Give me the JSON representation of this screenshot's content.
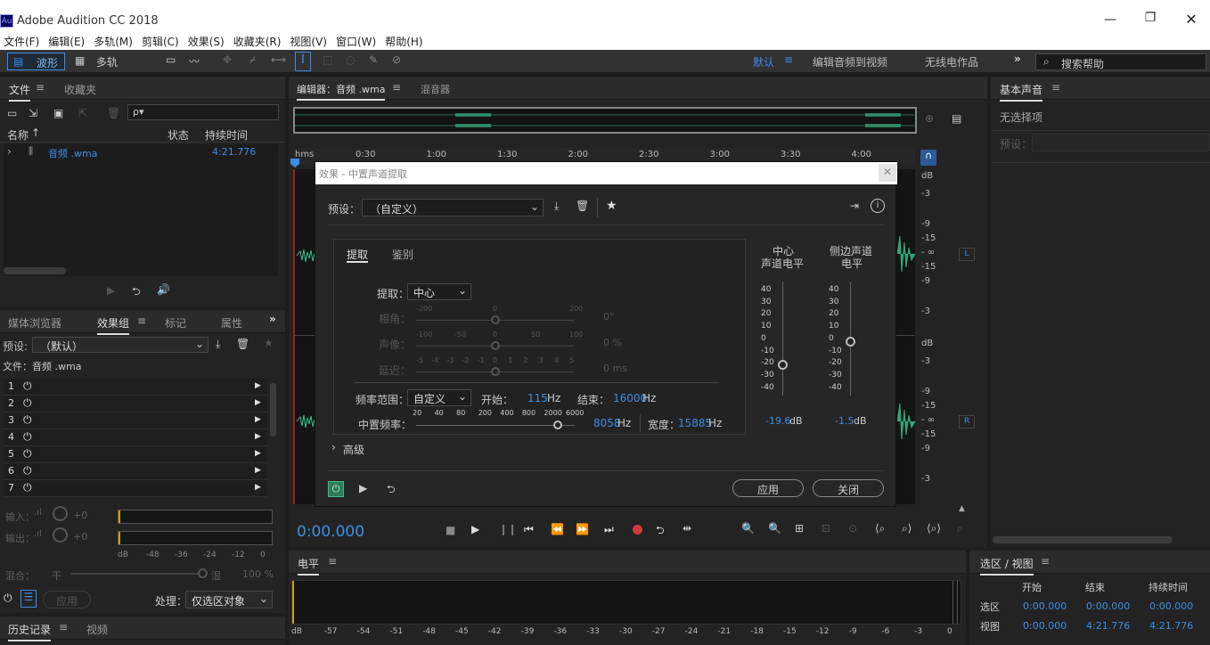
{
  "app": {
    "title": "Adobe Audition CC 2018",
    "logo": "Au"
  },
  "menu": [
    "文件(F)",
    "编辑(E)",
    "多轨(M)",
    "剪辑(C)",
    "效果(S)",
    "收藏夹(R)",
    "视图(V)",
    "窗口(W)",
    "帮助(H)"
  ],
  "toolbar": {
    "waveform_label": "波形",
    "multitrack_label": "多轨",
    "workspaces": [
      "默认",
      "编辑音频到视频",
      "无线电作品"
    ],
    "search_placeholder": "搜索帮助"
  },
  "files_panel": {
    "tabs": [
      "文件",
      "收藏夹"
    ],
    "col_name": "名称",
    "col_status": "状态",
    "col_duration": "持续时间",
    "file_name": "音频 .wma",
    "file_duration": "4:21.776",
    "search_placeholder": "ρ▾"
  },
  "effects_panel": {
    "tabs": [
      "媒体浏览器",
      "效果组",
      "标记",
      "属性"
    ],
    "preset_label": "预设:",
    "preset_value": "（默认）",
    "file_label": "文件：音频 .wma",
    "slots": [
      "1",
      "2",
      "3",
      "4",
      "5",
      "6",
      "7"
    ],
    "input_label": "输入：",
    "output_label": "输出：",
    "input_db": "+0",
    "output_db": "+0",
    "meter_ticks": [
      "dB",
      "-48",
      "-36",
      "-24",
      "-12",
      "0"
    ],
    "mix_label": "混合：",
    "mix_dry": "干",
    "mix_wet": "湿",
    "mix_pct": "100 %",
    "apply_label": "应用",
    "process_label": "处理：",
    "process_value": "仅选区对象"
  },
  "history": {
    "tabs": [
      "历史记录",
      "视频"
    ]
  },
  "editor": {
    "tab_editor": "编辑器：音频 .wma",
    "tab_mixer": "混音器",
    "timecode": "0:00.000",
    "ruler": [
      "hms",
      "0:30",
      "1:00",
      "1:30",
      "2:00",
      "2:30",
      "3:00",
      "3:30",
      "4:00"
    ],
    "db_top": [
      "dB",
      "-3",
      "-9",
      "-15",
      "- ∞",
      "-15",
      "-9",
      "-3"
    ],
    "db_bottom": [
      "dB",
      "-3",
      "-9",
      "-15",
      "- ∞",
      "-15",
      "-9",
      "-3"
    ],
    "ch_left": "L",
    "ch_right": "R"
  },
  "levels": {
    "title": "电平",
    "ticks": [
      "dB",
      "-57",
      "-54",
      "-51",
      "-48",
      "-45",
      "-42",
      "-39",
      "-36",
      "-33",
      "-30",
      "-27",
      "-24",
      "-21",
      "-18",
      "-15",
      "-12",
      "-9",
      "-6",
      "-3",
      "0"
    ]
  },
  "essential_sound": {
    "title": "基本声音",
    "no_selection": "无选择项",
    "preset_label": "预设："
  },
  "selection_view": {
    "title": "选区 / 视图",
    "col_start": "开始",
    "col_end": "结束",
    "col_duration": "持续时间",
    "row_sel": "选区",
    "row_view": "视图",
    "sel_start": "0:00.000",
    "sel_end": "0:00.000",
    "sel_dur": "0:00.000",
    "view_start": "0:00.000",
    "view_end": "4:21.776",
    "view_dur": "4:21.776"
  },
  "dialog": {
    "title": "效果 - 中置声道提取",
    "preset_label": "预设：",
    "preset_value": "（自定义）",
    "tab_extract": "提取",
    "tab_discriminate": "鉴别",
    "extract_label": "提取：",
    "extract_value": "中心",
    "phase_label": "相角：",
    "phase_ticks": [
      "-200",
      "0",
      "200"
    ],
    "phase_value": "0°",
    "pan_label": "声像：",
    "pan_ticks": [
      "-100",
      "-50",
      "0",
      "50",
      "100"
    ],
    "pan_value": "0 %",
    "delay_label": "延迟：",
    "delay_ticks": [
      "-5",
      "-4",
      "-3",
      "-2",
      "-1",
      "0",
      "1",
      "2",
      "3",
      "4",
      "5"
    ],
    "delay_value": "0 ms",
    "freq_range_label": "频率范围：",
    "freq_range_value": "自定义",
    "start_label": "开始：",
    "start_value": "115",
    "end_label": "结束：",
    "end_value": "16000",
    "hz": "Hz",
    "center_freq_label": "中置频率：",
    "center_ticks": [
      "20",
      "40",
      "80",
      "200",
      "400",
      "800",
      "2000",
      "6000"
    ],
    "center_value": "8058",
    "width_label": "宽度：",
    "width_value": "15885",
    "advanced_label": "高级",
    "center_level_title_1": "中心",
    "center_level_title_2": "声道电平",
    "side_level_title_1": "侧边声道",
    "side_level_title_2": "电平",
    "level_ticks": [
      "40",
      "30",
      "20",
      "10",
      "0",
      "-10",
      "-20",
      "-30",
      "-40"
    ],
    "center_level_value": "-19.6",
    "side_level_value": "-1.5",
    "db": "dB",
    "apply_label": "应用",
    "close_label": "关闭"
  },
  "colors": {
    "accent": "#3d8ee6",
    "wave": "#35c28b",
    "panel": "#232323",
    "record": "#d23a3a"
  }
}
